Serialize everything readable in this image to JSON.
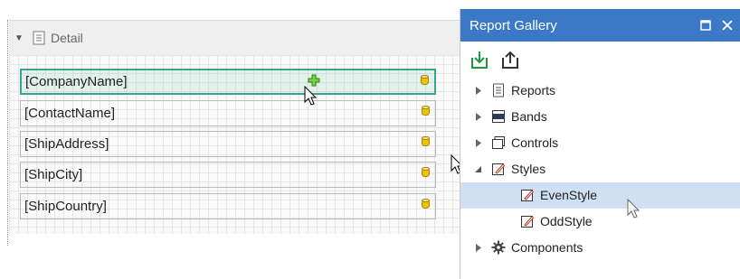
{
  "designer": {
    "band_label": "Detail",
    "fields": [
      {
        "text": "[CompanyName]",
        "selected": true
      },
      {
        "text": "[ContactName]",
        "selected": false
      },
      {
        "text": "[ShipAddress]",
        "selected": false
      },
      {
        "text": "[ShipCity]",
        "selected": false
      },
      {
        "text": "[ShipCountry]",
        "selected": false
      }
    ]
  },
  "gallery": {
    "title": "Report Gallery",
    "toolbar": [
      "import-icon",
      "export-icon"
    ],
    "items": [
      {
        "label": "Reports",
        "icon": "document-icon",
        "expanded": false
      },
      {
        "label": "Bands",
        "icon": "band-icon",
        "expanded": false
      },
      {
        "label": "Controls",
        "icon": "controls-icon",
        "expanded": false
      },
      {
        "label": "Styles",
        "icon": "style-icon",
        "expanded": true
      },
      {
        "label": "EvenStyle",
        "icon": "style-icon",
        "child": true,
        "selected": true
      },
      {
        "label": "OddStyle",
        "icon": "style-icon",
        "child": true,
        "selected": false
      },
      {
        "label": "Components",
        "icon": "gear-icon",
        "expanded": false
      }
    ]
  },
  "colors": {
    "accent": "#3b78c6",
    "selection": "#cfe0f5",
    "selected_field_border": "#3aa58c",
    "toolbar_green": "#1b9a3c"
  }
}
